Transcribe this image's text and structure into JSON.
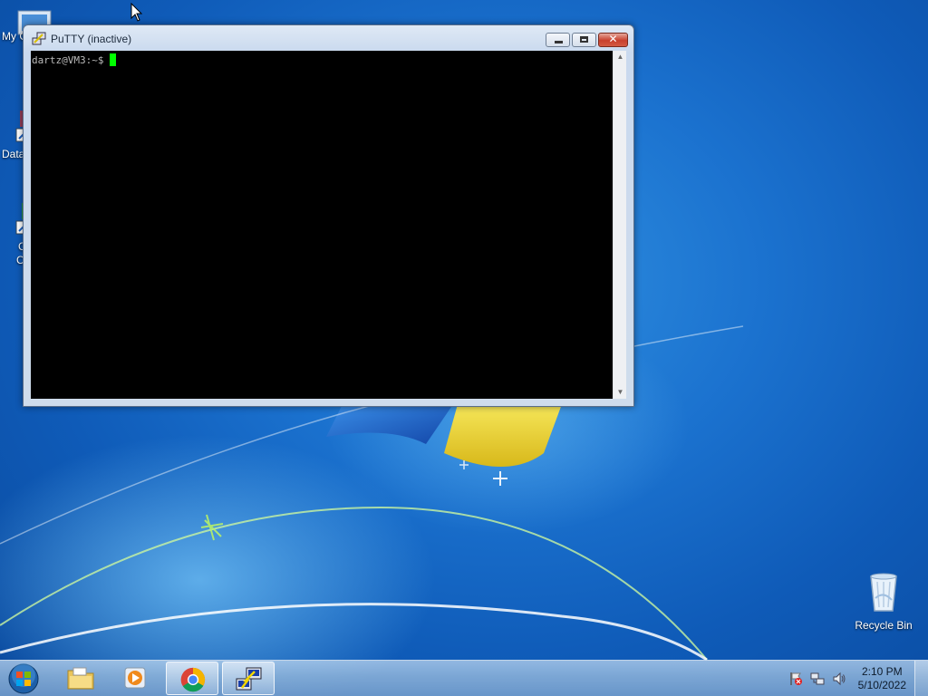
{
  "window": {
    "title": "PuTTY (inactive)",
    "minimize_icon": "minimize-icon",
    "maximize_icon": "maximize-icon",
    "close_icon": "close-icon",
    "close_glyph": "✕"
  },
  "terminal": {
    "prompt": "dartz@VM3:~$",
    "cursor_color": "#00ff00",
    "background": "#000000"
  },
  "desktop_icons": {
    "my_computer": "My C",
    "data": "Data",
    "third_top": "G",
    "third_bottom": "C",
    "recycle_bin": "Recycle Bin"
  },
  "taskbar": {
    "items": [
      {
        "name": "start-button",
        "icon": "windows-orb-icon"
      },
      {
        "name": "file-explorer",
        "icon": "folder-icon"
      },
      {
        "name": "media-player",
        "icon": "media-player-icon"
      },
      {
        "name": "chrome",
        "icon": "chrome-icon",
        "active": true
      },
      {
        "name": "putty",
        "icon": "putty-icon",
        "active": true
      }
    ]
  },
  "tray": {
    "time": "2:10 PM",
    "date": "5/10/2022",
    "icons": [
      "action-center-flag-icon",
      "network-icon",
      "speaker-icon"
    ]
  }
}
